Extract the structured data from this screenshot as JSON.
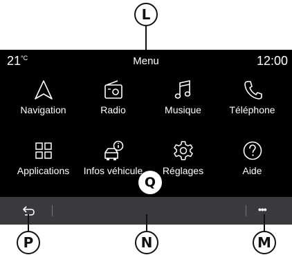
{
  "callouts": {
    "L": "L",
    "P": "P",
    "N": "N",
    "M": "M",
    "Q": "Q"
  },
  "status": {
    "temperature": "21",
    "temperature_unit": "°C",
    "title": "Menu",
    "time": "12:00"
  },
  "apps": [
    {
      "label": "Navigation",
      "icon": "navigation-arrow-icon"
    },
    {
      "label": "Radio",
      "icon": "radio-icon"
    },
    {
      "label": "Musique",
      "icon": "music-note-icon"
    },
    {
      "label": "Téléphone",
      "icon": "phone-icon"
    },
    {
      "label": "Applications",
      "icon": "apps-grid-icon"
    },
    {
      "label": "Infos véhicule",
      "icon": "vehicle-info-icon"
    },
    {
      "label": "Réglages",
      "icon": "gear-icon"
    },
    {
      "label": "Aide",
      "icon": "help-icon"
    }
  ],
  "bottom_bar": {
    "back_icon": "back-arrow-icon",
    "more_icon": "more-dots-icon",
    "more_label": "•••"
  },
  "colors": {
    "screen_bg": "#000000",
    "bottom_bar_bg": "#3a3a3c",
    "text": "#ffffff"
  }
}
